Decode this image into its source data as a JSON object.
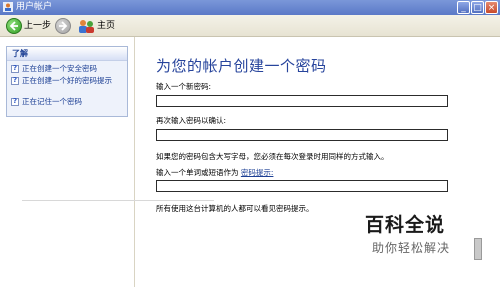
{
  "window": {
    "title": "用户帐户"
  },
  "nav": {
    "back_label": "上一步",
    "home_label": "主页"
  },
  "sidebar": {
    "heading": "了解",
    "items": [
      {
        "label": "正在创建一个安全密码"
      },
      {
        "label": "正在创建一个好的密码提示"
      },
      {
        "label": "正在记住一个密码"
      }
    ]
  },
  "main": {
    "heading": "为您的帐户创建一个密码",
    "new_password_label": "输入一个新密码:",
    "new_password_value": "",
    "confirm_label": "再次输入密码以确认:",
    "confirm_value": "",
    "case_note": "如果您的密码包含大写字母，您必须在每次登录时用同样的方式输入。",
    "hint_prompt": "输入一个单词或短语作为",
    "hint_link": "密码提示:",
    "hint_value": "",
    "hint_note": "所有使用这台计算机的人都可以看见密码提示。"
  },
  "watermark": {
    "brand": "百科全说",
    "tagline": "助你轻松解决"
  }
}
